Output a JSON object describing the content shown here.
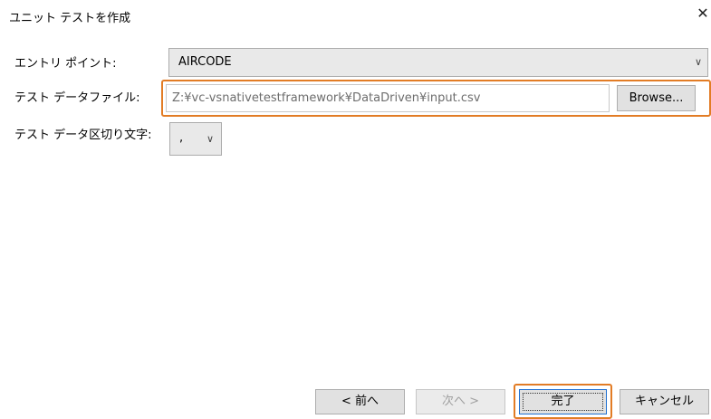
{
  "window": {
    "title": "ユニット テストを作成",
    "close_glyph": "✕"
  },
  "form": {
    "entry_point_label": "エントリ ポイント:",
    "entry_point_value": "AIRCODE",
    "test_data_file_label": "テスト データファイル:",
    "test_data_file_value": "Z:¥vc-vsnativetestframework¥DataDriven¥input.csv",
    "browse_label": "Browse...",
    "delimiter_label": "テスト データ区切り文字:",
    "delimiter_value": ","
  },
  "footer": {
    "prev_label": "< 前へ",
    "next_label": "次へ >",
    "finish_label": "完了",
    "cancel_label": "キャンセル"
  },
  "icons": {
    "chevron": "chevron-down-icon",
    "close": "close-icon"
  },
  "colors": {
    "highlight": "#e27c25",
    "button_bg": "#e1e1e1",
    "focus_border": "#1f6fd0"
  }
}
